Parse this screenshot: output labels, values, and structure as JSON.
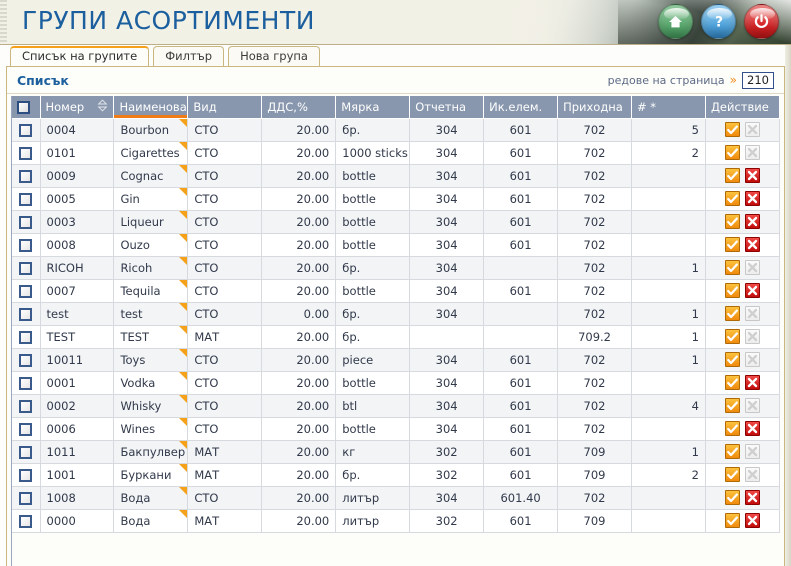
{
  "header": {
    "title": "ГРУПИ АСОРТИМЕНТИ",
    "buttons": [
      {
        "name": "home-icon",
        "label": "Начало"
      },
      {
        "name": "help-icon",
        "label": "Помощ"
      },
      {
        "name": "power-icon",
        "label": "Изход"
      }
    ],
    "accent_color": "#1b5f9e",
    "banner_bg": "#f2f1e6"
  },
  "tabs": [
    {
      "label": "Списък на групите",
      "active": true
    },
    {
      "label": "Филтър",
      "active": false
    },
    {
      "label": "Нова група",
      "active": false
    }
  ],
  "panel": {
    "caption": "Списък",
    "rows_per_page_label": "редове на страница",
    "rows_per_page_chevron": "»",
    "rows_per_page_value": "210",
    "rows_per_page_placeholder": "210"
  },
  "grid": {
    "sorted_column": "Наименование",
    "sort_direction": "desc",
    "header_bg": "#8897ad",
    "sort_accent": "#f07c18",
    "columns": [
      {
        "key": "check",
        "label": "",
        "sortable": false
      },
      {
        "key": "num",
        "label": "Номер",
        "sortable": true
      },
      {
        "key": "name",
        "label": "Наименование",
        "sortable": true
      },
      {
        "key": "kind",
        "label": "Вид",
        "sortable": false
      },
      {
        "key": "vat",
        "label": "ДДС,%",
        "sortable": false
      },
      {
        "key": "unit",
        "label": "Мярка",
        "sortable": false
      },
      {
        "key": "acc",
        "label": "Отчетна",
        "sortable": false
      },
      {
        "key": "ec",
        "label": "Ик.елем.",
        "sortable": false
      },
      {
        "key": "inc",
        "label": "Приходна",
        "sortable": false
      },
      {
        "key": "cnt",
        "label": "# *",
        "sortable": false
      },
      {
        "key": "act",
        "label": "Действие",
        "sortable": false
      }
    ],
    "rows": [
      {
        "num": "0004",
        "name": "Bourbon",
        "kind": "СТО",
        "vat": "20.00",
        "unit": "бр.",
        "acc": "304",
        "ec": "601",
        "inc": "702",
        "cnt": "5",
        "can_delete": false
      },
      {
        "num": "0101",
        "name": "Cigarettes",
        "kind": "СТО",
        "vat": "20.00",
        "unit": "1000 sticks",
        "acc": "304",
        "ec": "601",
        "inc": "702",
        "cnt": "2",
        "can_delete": false
      },
      {
        "num": "0009",
        "name": "Cognac",
        "kind": "СТО",
        "vat": "20.00",
        "unit": "bottle",
        "acc": "304",
        "ec": "601",
        "inc": "702",
        "cnt": "",
        "can_delete": true
      },
      {
        "num": "0005",
        "name": "Gin",
        "kind": "СТО",
        "vat": "20.00",
        "unit": "bottle",
        "acc": "304",
        "ec": "601",
        "inc": "702",
        "cnt": "",
        "can_delete": true
      },
      {
        "num": "0003",
        "name": "Liqueur",
        "kind": "СТО",
        "vat": "20.00",
        "unit": "bottle",
        "acc": "304",
        "ec": "601",
        "inc": "702",
        "cnt": "",
        "can_delete": true
      },
      {
        "num": "0008",
        "name": "Ouzo",
        "kind": "СТО",
        "vat": "20.00",
        "unit": "bottle",
        "acc": "304",
        "ec": "601",
        "inc": "702",
        "cnt": "",
        "can_delete": true
      },
      {
        "num": "RICOH",
        "name": "Ricoh",
        "kind": "СТО",
        "vat": "20.00",
        "unit": "бр.",
        "acc": "304",
        "ec": "",
        "inc": "702",
        "cnt": "1",
        "can_delete": false
      },
      {
        "num": "0007",
        "name": "Tequila",
        "kind": "СТО",
        "vat": "20.00",
        "unit": "bottle",
        "acc": "304",
        "ec": "601",
        "inc": "702",
        "cnt": "",
        "can_delete": true
      },
      {
        "num": "test",
        "name": "test",
        "kind": "СТО",
        "vat": "0.00",
        "unit": "бр.",
        "acc": "304",
        "ec": "",
        "inc": "702",
        "cnt": "1",
        "can_delete": false
      },
      {
        "num": "TEST",
        "name": "TEST",
        "kind": "МАТ",
        "vat": "20.00",
        "unit": "бр.",
        "acc": "",
        "ec": "",
        "inc": "709.2",
        "cnt": "1",
        "can_delete": false
      },
      {
        "num": "10011",
        "name": "Toys",
        "kind": "СТО",
        "vat": "20.00",
        "unit": "piece",
        "acc": "304",
        "ec": "601",
        "inc": "702",
        "cnt": "1",
        "can_delete": false
      },
      {
        "num": "0001",
        "name": "Vodka",
        "kind": "СТО",
        "vat": "20.00",
        "unit": "bottle",
        "acc": "304",
        "ec": "601",
        "inc": "702",
        "cnt": "",
        "can_delete": true
      },
      {
        "num": "0002",
        "name": "Whisky",
        "kind": "СТО",
        "vat": "20.00",
        "unit": "btl",
        "acc": "304",
        "ec": "601",
        "inc": "702",
        "cnt": "4",
        "can_delete": false
      },
      {
        "num": "0006",
        "name": "Wines",
        "kind": "СТО",
        "vat": "20.00",
        "unit": "bottle",
        "acc": "304",
        "ec": "601",
        "inc": "702",
        "cnt": "",
        "can_delete": true
      },
      {
        "num": "1011",
        "name": "Бакпулвер",
        "kind": "МАТ",
        "vat": "20.00",
        "unit": "кг",
        "acc": "302",
        "ec": "601",
        "inc": "709",
        "cnt": "1",
        "can_delete": false
      },
      {
        "num": "1001",
        "name": "Буркани",
        "kind": "МАТ",
        "vat": "20.00",
        "unit": "бр.",
        "acc": "302",
        "ec": "601",
        "inc": "709",
        "cnt": "2",
        "can_delete": false
      },
      {
        "num": "1008",
        "name": "Вода",
        "kind": "СТО",
        "vat": "20.00",
        "unit": "литър",
        "acc": "304",
        "ec": "601.40",
        "inc": "702",
        "cnt": "",
        "can_delete": true
      },
      {
        "num": "0000",
        "name": "Вода",
        "kind": "МАТ",
        "vat": "20.00",
        "unit": "литър",
        "acc": "302",
        "ec": "601",
        "inc": "709",
        "cnt": "",
        "can_delete": true
      }
    ],
    "row_icons": {
      "edit": "edit-check-icon",
      "delete": "delete-x-icon",
      "flag": "note-corner-flag-icon",
      "checkbox": "row-checkbox"
    }
  }
}
